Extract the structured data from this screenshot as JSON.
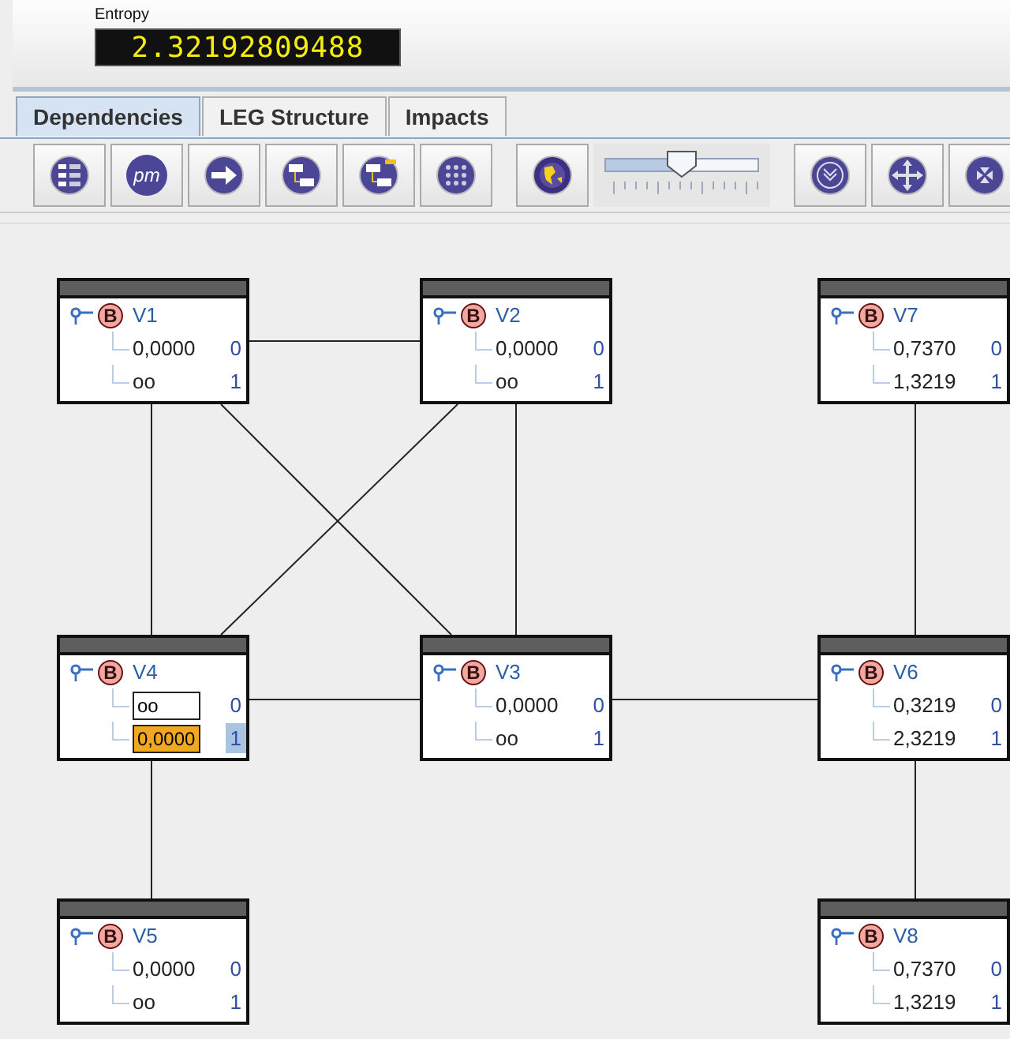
{
  "entropy": {
    "label": "Entropy",
    "value": "2.32192809488"
  },
  "tabs": [
    {
      "label": "Dependencies",
      "selected": true
    },
    {
      "label": "LEG Structure",
      "selected": false
    },
    {
      "label": "Impacts",
      "selected": false
    }
  ],
  "toolbar": [
    {
      "kind": "list"
    },
    {
      "kind": "text",
      "label": "pm"
    },
    {
      "kind": "arrow"
    },
    {
      "kind": "diagram"
    },
    {
      "kind": "diagram-plus"
    },
    {
      "kind": "grid"
    },
    {
      "kind": "globe"
    },
    {
      "kind": "slider",
      "level": 0.5
    },
    {
      "kind": "download"
    },
    {
      "kind": "move"
    },
    {
      "kind": "collapse"
    }
  ],
  "nodes": [
    {
      "name": "V1",
      "type": "B",
      "rows": [
        {
          "kind": "plain",
          "value": "0,0000",
          "state": "0",
          "selected": false
        },
        {
          "kind": "plain",
          "value": "oo",
          "state": "1",
          "selected": false
        }
      ]
    },
    {
      "name": "V2",
      "type": "B",
      "rows": [
        {
          "kind": "plain",
          "value": "0,0000",
          "state": "0",
          "selected": false
        },
        {
          "kind": "plain",
          "value": "oo",
          "state": "1",
          "selected": false
        }
      ]
    },
    {
      "name": "V7",
      "type": "B",
      "rows": [
        {
          "kind": "plain",
          "value": "0,7370",
          "state": "0",
          "selected": false
        },
        {
          "kind": "plain",
          "value": "1,3219",
          "state": "1",
          "selected": false
        }
      ]
    },
    {
      "name": "V4",
      "type": "B",
      "rows": [
        {
          "kind": "field",
          "value": "oo",
          "state": "0",
          "selected": false
        },
        {
          "kind": "field",
          "value": "0,0000",
          "state": "1",
          "selected": true
        }
      ]
    },
    {
      "name": "V3",
      "type": "B",
      "rows": [
        {
          "kind": "plain",
          "value": "0,0000",
          "state": "0",
          "selected": false
        },
        {
          "kind": "plain",
          "value": "oo",
          "state": "1",
          "selected": false
        }
      ]
    },
    {
      "name": "V6",
      "type": "B",
      "rows": [
        {
          "kind": "plain",
          "value": "0,3219",
          "state": "0",
          "selected": false
        },
        {
          "kind": "plain",
          "value": "2,3219",
          "state": "1",
          "selected": false
        }
      ]
    },
    {
      "name": "V5",
      "type": "B",
      "rows": [
        {
          "kind": "plain",
          "value": "0,0000",
          "state": "0",
          "selected": false
        },
        {
          "kind": "plain",
          "value": "oo",
          "state": "1",
          "selected": false
        }
      ]
    },
    {
      "name": "V8",
      "type": "B",
      "rows": [
        {
          "kind": "plain",
          "value": "0,7370",
          "state": "0",
          "selected": false
        },
        {
          "kind": "plain",
          "value": "1,3219",
          "state": "1",
          "selected": false
        }
      ]
    }
  ]
}
